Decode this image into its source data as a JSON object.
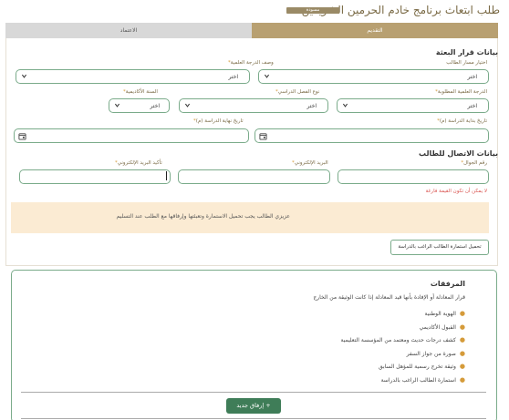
{
  "header": {
    "title": "طلب ابتعاث برنامج خادم الحرمين الشريفين",
    "badge": "مسودة"
  },
  "tabs": [
    {
      "label": "التقديم",
      "active": true
    },
    {
      "label": "الاعتماد",
      "active": false
    }
  ],
  "scholarship_section": {
    "title": "بيانات قرار البعثة",
    "study_path_label": "اختيار مسار الطالب",
    "study_path_value": "اختر",
    "degree_desc_label": "وصف الدرجة العلمية",
    "degree_desc_value": "اختر",
    "required_degree_label": "الدرجة العلمية المطلوبة",
    "required_degree_value": "اختر",
    "study_type_label": "نوع الفصل الدراسي",
    "study_type_value": "اختر",
    "academic_year_label": "السنة الأكاديمية",
    "academic_year_value": "اختر",
    "start_date_label": "تاريخ بداية الدراسة (م)",
    "end_date_label": "تاريخ نهاية الدراسة (م)"
  },
  "contact_section": {
    "title": "بيانات الاتصال للطالب",
    "mobile_label": "رقم الجوال",
    "mobile_value": "",
    "mobile_error": "لا يمكن أن تكون القيمة فارغة",
    "email_label": "البريد الإلكتروني",
    "email_value": "",
    "email_confirm_label": "تأكيد البريد الإلكتروني",
    "email_confirm_value": ""
  },
  "notice": {
    "text": "عزيزي الطالب يجب تحميل الاستمارة وتعبئتها وإرفاقها مع الطلب عند التسليم"
  },
  "download_button": "تحميل استمارة الطالب الراغب بالدراسة",
  "attachments": {
    "title": "المرفقات",
    "intro": "قرار المعادلة أو الإفادة بأنها قيد المعادلة إذا كانت الوثيقة من الخارج",
    "items": [
      "الهوية الوطنية",
      "القبول الأكاديمي",
      "كشف درجات حديث ومعتمد من المؤسسة التعليمية",
      "صورة من جواز السفر",
      "وثيقة تخرج رسمية للمؤهل السابق",
      "استمارة الطالب الراغب بالدراسة"
    ],
    "add_button": "إرفاق جديد"
  },
  "colors": {
    "accent_gold": "#b8a071",
    "field_border": "#7aab8a",
    "required": "#d59b3a",
    "error": "#d9534f",
    "notice_bg": "#fbebd3",
    "button_green": "#3f7d58"
  }
}
